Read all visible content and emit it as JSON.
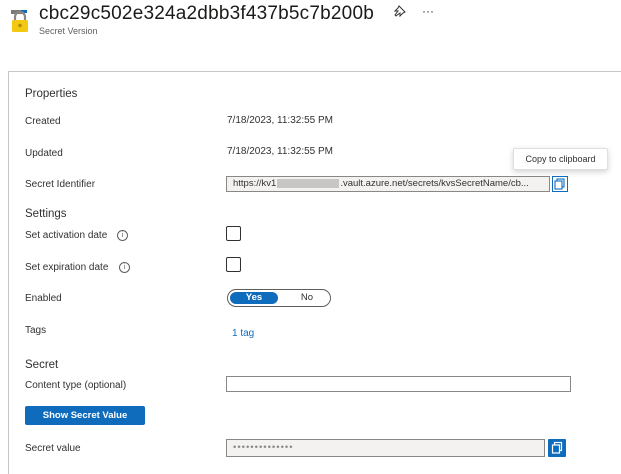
{
  "header": {
    "title": "cbc29c502e324a2dbb3f437b5c7b200b",
    "subtitle": "Secret Version",
    "icon": "key-vault-secret-icon",
    "pin_icon": "pin-icon",
    "more_label": "···"
  },
  "properties": {
    "section_label": "Properties",
    "created_label": "Created",
    "created_value": "7/18/2023, 11:32:55 PM",
    "updated_label": "Updated",
    "updated_value": "7/18/2023, 11:32:55 PM",
    "identifier_label": "Secret Identifier",
    "identifier_value_start": "https://kv1",
    "identifier_value_end": ".vault.azure.net/secrets/kvsSecretName/cb...",
    "copy_tooltip": "Copy to clipboard"
  },
  "settings": {
    "section_label": "Settings",
    "activation_label": "Set activation date",
    "expiration_label": "Set expiration date",
    "enabled_label": "Enabled",
    "enabled_yes": "Yes",
    "enabled_no": "No",
    "enabled_selected": "Yes",
    "tags_label": "Tags",
    "tags_value": "1 tag"
  },
  "secret": {
    "section_label": "Secret",
    "content_type_label": "Content type (optional)",
    "content_type_value": "",
    "show_button": "Show Secret Value",
    "value_label": "Secret value",
    "value_masked": "••••••••••••••"
  },
  "colors": {
    "accent": "#0f6cbd",
    "key_icon": "#f2c811",
    "redaction": "#c8c6c4"
  }
}
